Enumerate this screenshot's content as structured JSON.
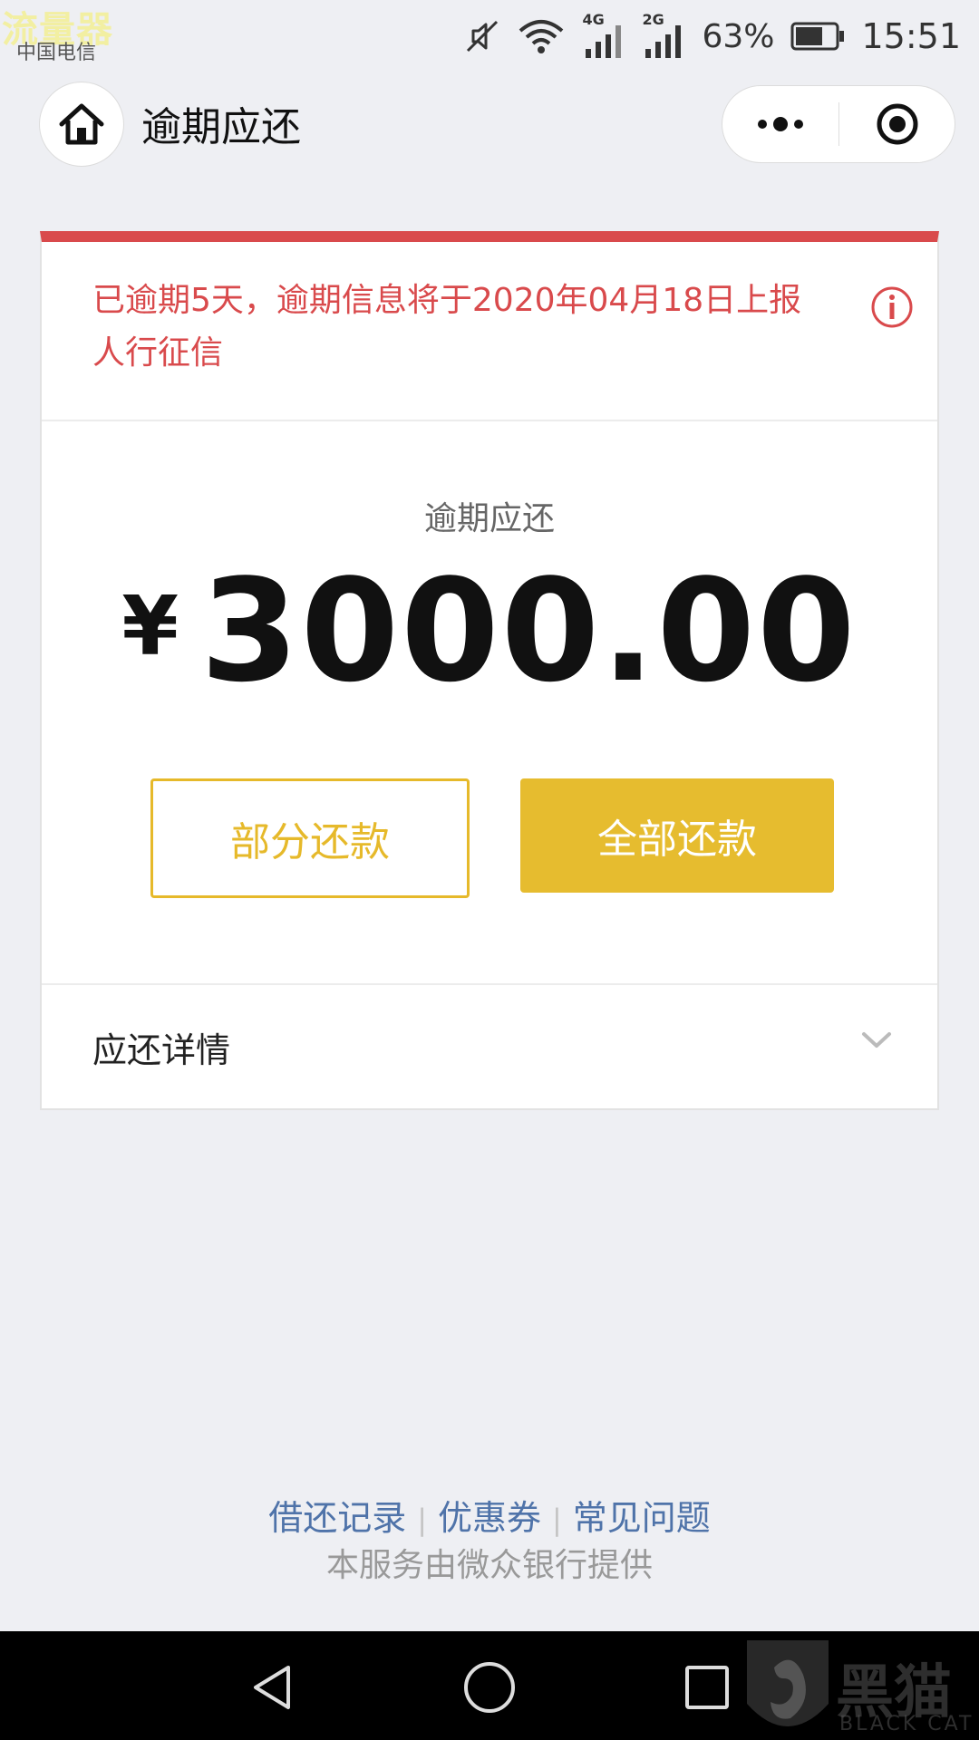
{
  "status_bar": {
    "watermark": "流量器",
    "carrier": "中国电信",
    "network_4g": "4G",
    "network_2g": "2G",
    "battery": "63%",
    "time": "15:51"
  },
  "header": {
    "title": "逾期应还"
  },
  "alert": {
    "message": "已逾期5天，逾期信息将于2020年04月18日上报人行征信"
  },
  "amount": {
    "label": "逾期应还",
    "currency": "¥",
    "value": "3000.00"
  },
  "buttons": {
    "partial": "部分还款",
    "full": "全部还款"
  },
  "details": {
    "label": "应还详情"
  },
  "footer": {
    "links": [
      "借还记录",
      "优惠券",
      "常见问题"
    ],
    "separator": "|",
    "provider": "本服务由微众银行提供"
  },
  "watermark_logo": {
    "text": "黑猫",
    "sub": "BLACK CAT"
  },
  "colors": {
    "alert_red": "#d94a4c",
    "accent_gold": "#e6bc2f",
    "link_blue": "#4f73a9",
    "background": "#eeeff3"
  }
}
